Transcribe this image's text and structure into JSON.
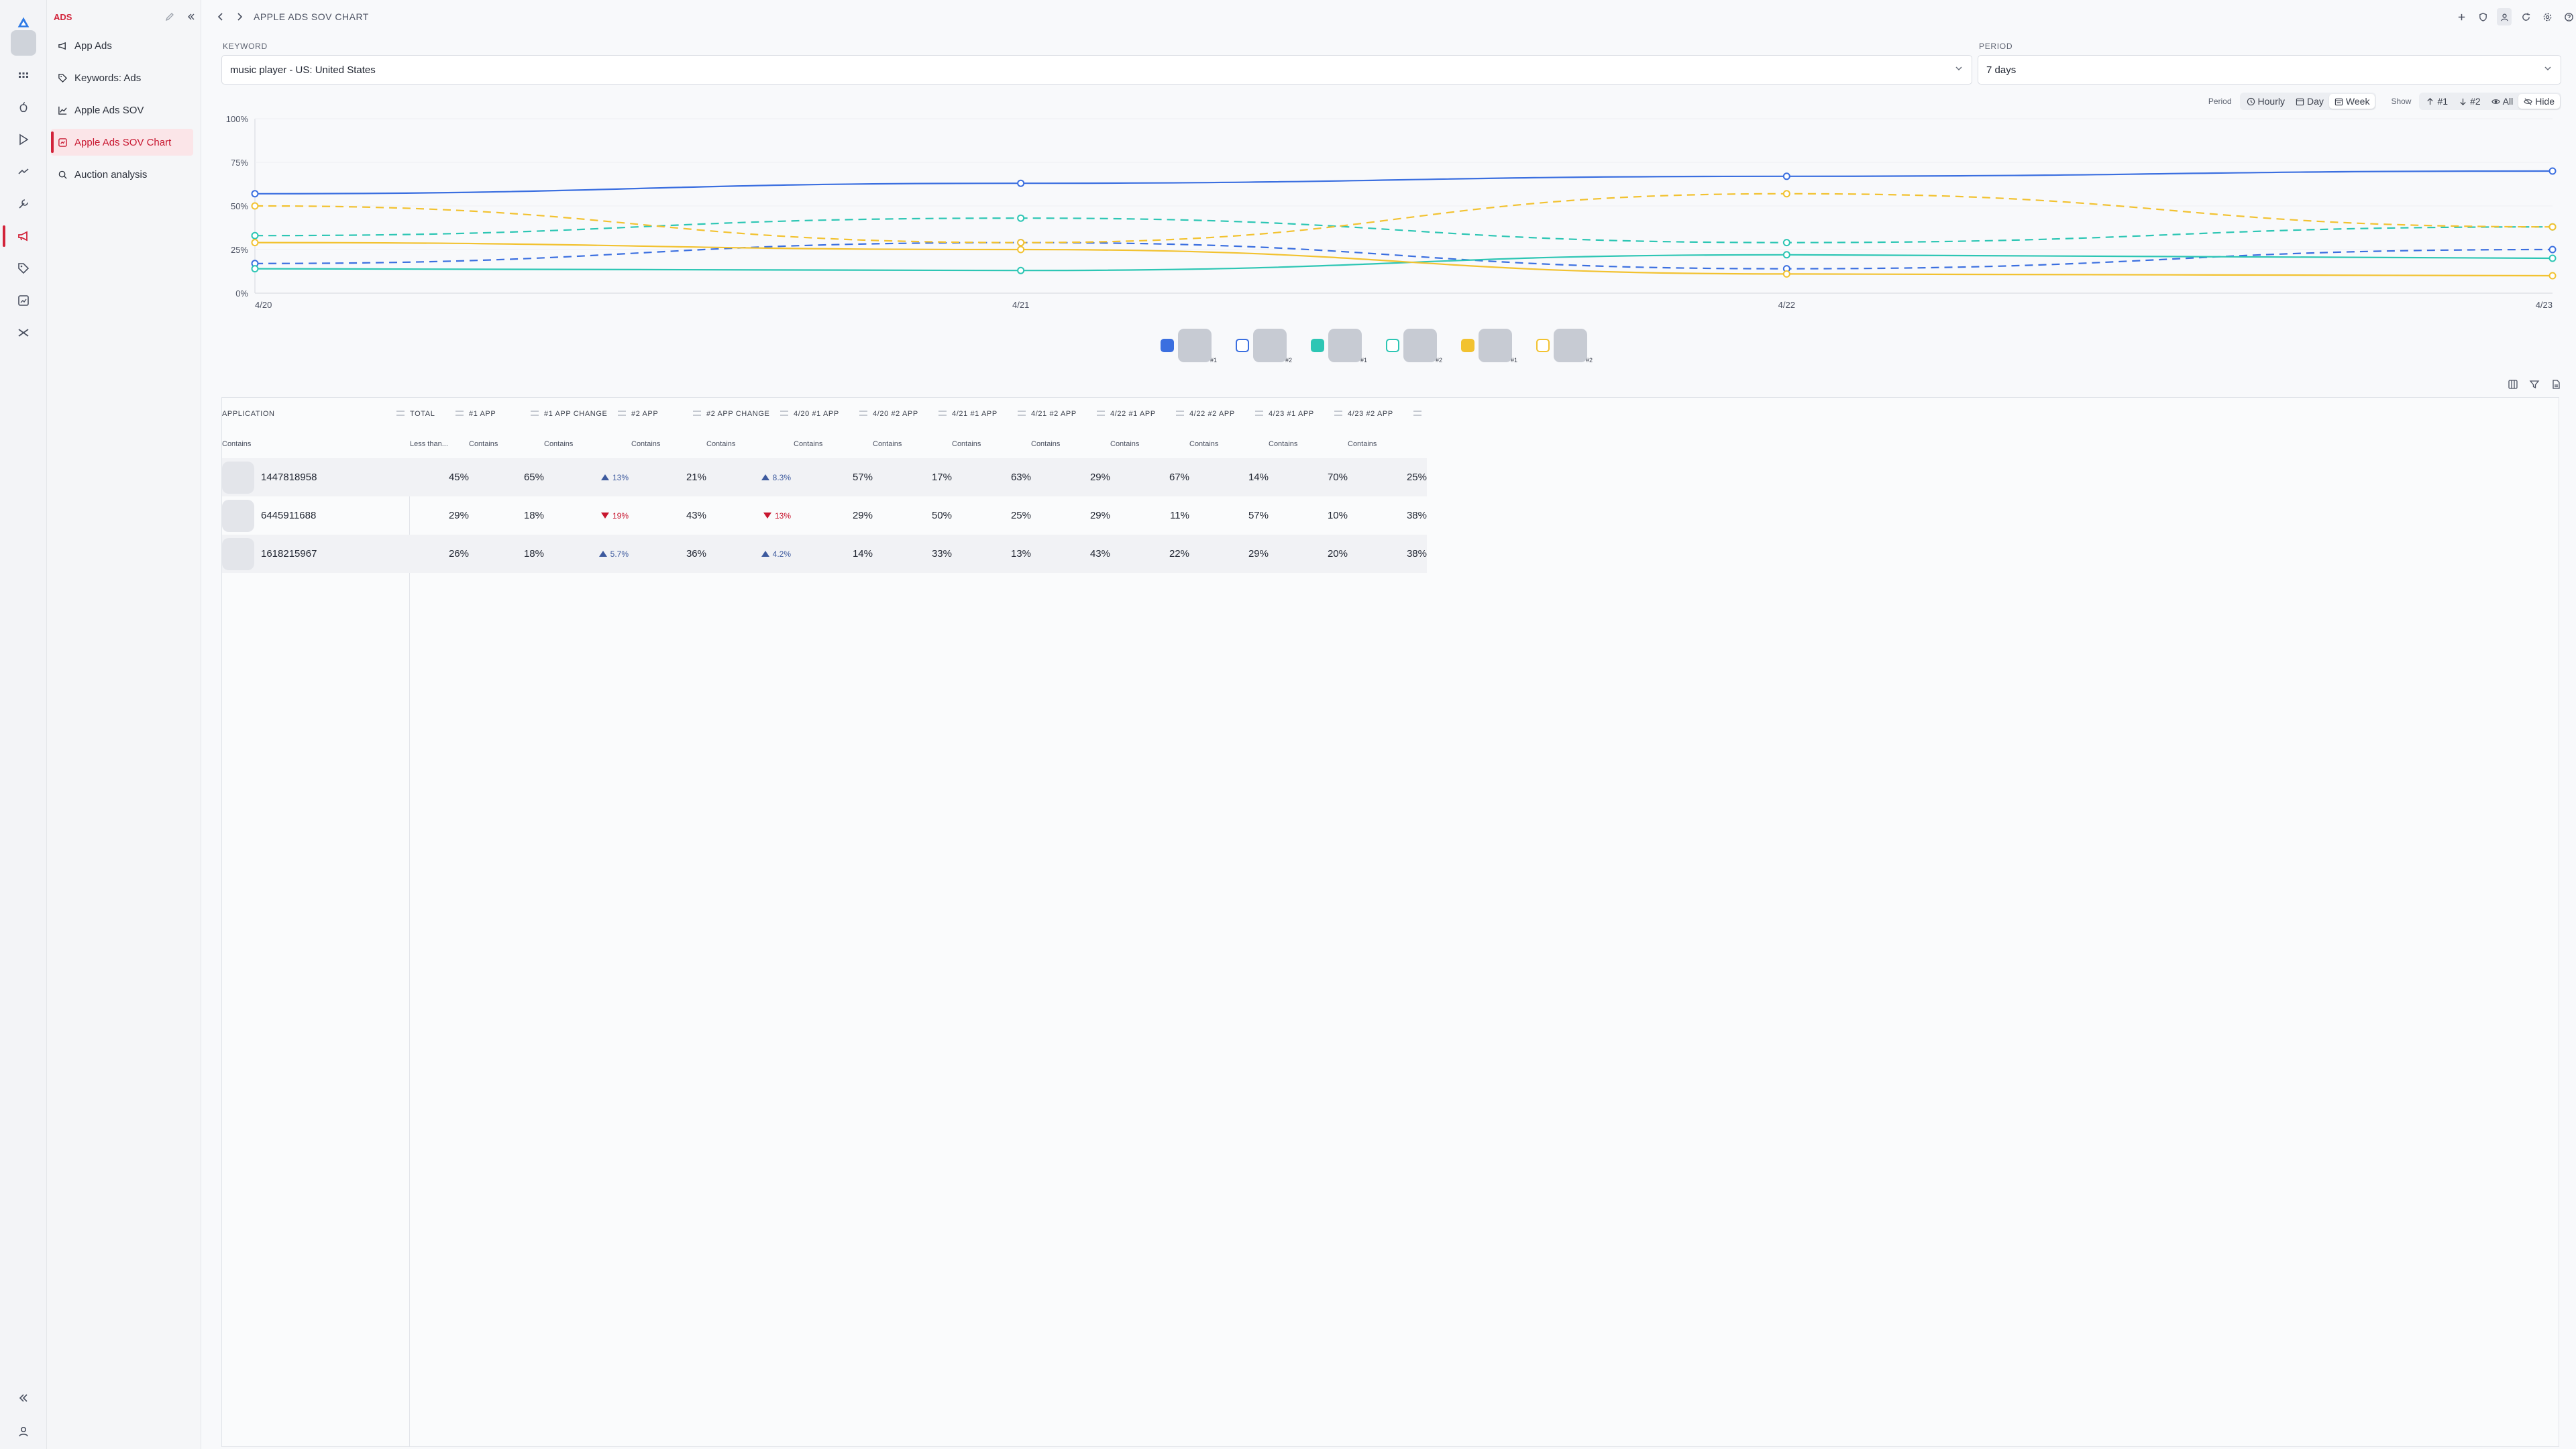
{
  "nav": {
    "section_title": "ADS",
    "items": [
      {
        "label": "App Ads",
        "icon": "megaphone-icon"
      },
      {
        "label": "Keywords: Ads",
        "icon": "tags-icon"
      },
      {
        "label": "Apple Ads SOV",
        "icon": "line-chart-icon"
      },
      {
        "label": "Apple Ads SOV Chart",
        "icon": "chart-box-icon",
        "active": true
      },
      {
        "label": "Auction analysis",
        "icon": "search-chart-icon"
      }
    ]
  },
  "breadcrumb": {
    "title": "APPLE ADS SOV CHART"
  },
  "filters": {
    "keyword_label": "KEYWORD",
    "keyword_value": "music player - US: United States",
    "period_label": "PERIOD",
    "period_value": "7 days"
  },
  "toolbar": {
    "period_label": "Period",
    "period_options": [
      "Hourly",
      "Day",
      "Week"
    ],
    "period_selected": "Day",
    "show_label": "Show",
    "show_options": [
      "#1",
      "#2",
      "All",
      "Hide"
    ]
  },
  "chart_data": {
    "type": "line",
    "x": [
      "4/20",
      "4/21",
      "4/22",
      "4/23"
    ],
    "ylim": [
      0,
      100
    ],
    "yticks": [
      "0%",
      "25%",
      "50%",
      "75%",
      "100%"
    ],
    "series": [
      {
        "app": "1447818958",
        "rank": "#1",
        "color": "#3b6fe0",
        "dashed": false,
        "values": [
          57,
          63,
          67,
          70
        ]
      },
      {
        "app": "1447818958",
        "rank": "#2",
        "color": "#3b6fe0",
        "dashed": true,
        "values": [
          17,
          29,
          14,
          25
        ]
      },
      {
        "app": "6445911688",
        "rank": "#1",
        "color": "#2dc6b4",
        "dashed": false,
        "values": [
          14,
          13,
          22,
          20
        ]
      },
      {
        "app": "6445911688",
        "rank": "#2",
        "color": "#2dc6b4",
        "dashed": true,
        "values": [
          33,
          43,
          29,
          38
        ]
      },
      {
        "app": "1618215967",
        "rank": "#1",
        "color": "#f2c230",
        "dashed": false,
        "values": [
          29,
          25,
          11,
          10
        ]
      },
      {
        "app": "1618215967",
        "rank": "#2",
        "color": "#f2c230",
        "dashed": true,
        "values": [
          50,
          29,
          57,
          38
        ]
      }
    ]
  },
  "legend": [
    {
      "rank": "#1",
      "color": "#3b6fe0",
      "style": "solid"
    },
    {
      "rank": "#2",
      "color": "#3b6fe0",
      "style": "outline"
    },
    {
      "rank": "#1",
      "color": "#2dc6b4",
      "style": "solid"
    },
    {
      "rank": "#2",
      "color": "#2dc6b4",
      "style": "outline"
    },
    {
      "rank": "#1",
      "color": "#f2c230",
      "style": "solid"
    },
    {
      "rank": "#2",
      "color": "#f2c230",
      "style": "outline"
    }
  ],
  "table": {
    "columns": [
      "APPLICATION",
      "TOTAL",
      "#1 APP",
      "#1 APP CHANGE",
      "#2 APP",
      "#2 APP CHANGE",
      "4/20 #1 APP",
      "4/20 #2 APP",
      "4/21 #1 APP",
      "4/21 #2 APP",
      "4/22 #1 APP",
      "4/22 #2 APP",
      "4/23 #1 APP",
      "4/23 #2 APP"
    ],
    "filters": [
      "Contains",
      "Less than...",
      "Contains",
      "Contains",
      "Contains",
      "Contains",
      "Contains",
      "Contains",
      "Contains",
      "Contains",
      "Contains",
      "Contains",
      "Contains",
      "Contains"
    ],
    "rows": [
      {
        "app": "1447818958",
        "total": "45%",
        "app1": "65%",
        "app1_change": "13%",
        "app1_dir": "up",
        "app2": "21%",
        "app2_change": "8.3%",
        "app2_dir": "up",
        "d420_1": "57%",
        "d420_2": "17%",
        "d421_1": "63%",
        "d421_2": "29%",
        "d422_1": "67%",
        "d422_2": "14%",
        "d423_1": "70%",
        "d423_2": "25%"
      },
      {
        "app": "6445911688",
        "total": "29%",
        "app1": "18%",
        "app1_change": "19%",
        "app1_dir": "down",
        "app2": "43%",
        "app2_change": "13%",
        "app2_dir": "down",
        "d420_1": "29%",
        "d420_2": "50%",
        "d421_1": "25%",
        "d421_2": "29%",
        "d422_1": "11%",
        "d422_2": "57%",
        "d423_1": "10%",
        "d423_2": "38%"
      },
      {
        "app": "1618215967",
        "total": "26%",
        "app1": "18%",
        "app1_change": "5.7%",
        "app1_dir": "up",
        "app2": "36%",
        "app2_change": "4.2%",
        "app2_dir": "up",
        "d420_1": "14%",
        "d420_2": "33%",
        "d421_1": "13%",
        "d421_2": "43%",
        "d422_1": "22%",
        "d422_2": "29%",
        "d423_1": "20%",
        "d423_2": "38%"
      }
    ]
  }
}
